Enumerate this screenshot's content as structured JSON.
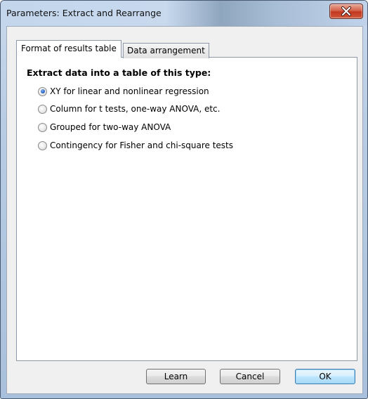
{
  "window": {
    "title": "Parameters: Extract and Rearrange"
  },
  "tabs": [
    {
      "label": "Format of results table",
      "active": true
    },
    {
      "label": "Data arrangement",
      "active": false
    }
  ],
  "panel": {
    "heading": "Extract data into a table of this type:",
    "options": [
      {
        "label": "XY for linear and nonlinear regression",
        "checked": true
      },
      {
        "label": "Column for t tests, one-way ANOVA, etc.",
        "checked": false
      },
      {
        "label": "Grouped for two-way ANOVA",
        "checked": false
      },
      {
        "label": "Contingency for Fisher and chi-square tests",
        "checked": false
      }
    ]
  },
  "buttons": {
    "learn": "Learn",
    "cancel": "Cancel",
    "ok": "OK"
  },
  "colors": {
    "accent": "#2b63c6",
    "close_button": "#c2371e"
  },
  "icons": {
    "close": "close-icon"
  }
}
